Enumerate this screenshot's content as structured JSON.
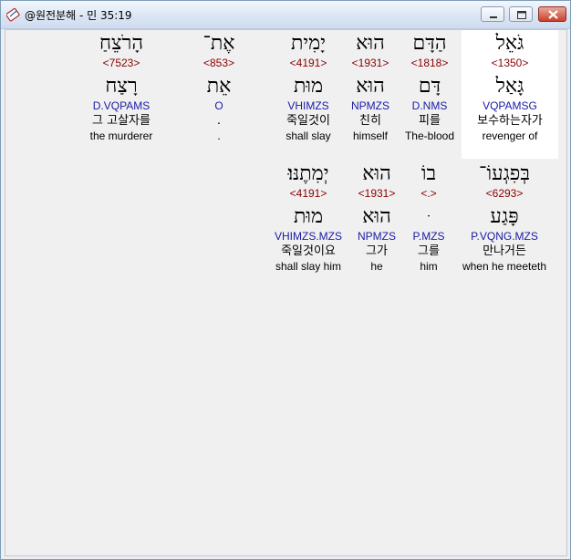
{
  "window": {
    "title": "@원전분해 - 민 35:19",
    "buttons": {
      "minimize": "minimize",
      "maximize": "maximize",
      "close": "close"
    }
  },
  "rows": [
    {
      "words": [
        {
          "hebrew": "גֹּאֵל",
          "strong": "<1350>",
          "lemma": "גָּאַל",
          "morph": "VQPAMSG",
          "korean": "보수하는자가",
          "english": "revenger of",
          "selected": true
        },
        {
          "hebrew": "הַדָּם",
          "strong": "<1818>",
          "lemma": "דָּם",
          "morph": "D.NMS",
          "korean": "피를",
          "english": "The-blood"
        },
        {
          "hebrew": "הוּא",
          "strong": "<1931>",
          "lemma": "הוּא",
          "morph": "NPMZS",
          "korean": "친히",
          "english": "himself"
        },
        {
          "hebrew": "יָמִית",
          "strong": "<4191>",
          "lemma": "מוּת",
          "morph": "VHIMZS",
          "korean": "죽일것이",
          "english": "shall slay"
        },
        {
          "hebrew": "אֶת־",
          "strong": "<853>",
          "lemma": "אֵת",
          "morph": "O",
          "korean": ".",
          "english": "."
        },
        {
          "hebrew": "הָרֹצֵחַ",
          "strong": "<7523>",
          "lemma": "רָצַח",
          "morph": "D.VQPAMS",
          "korean": "그 고살자를",
          "english": "the murderer"
        }
      ]
    },
    {
      "words": [
        {
          "hebrew": "בְּפִגְעוֹ־",
          "strong": "<6293>",
          "lemma": "פָּגַע",
          "morph": "P.VQNG.MZS",
          "korean": "만나거든",
          "english": "when he meeteth"
        },
        {
          "hebrew": "בוֹ",
          "strong": "<.>",
          "lemma": "ּ",
          "morph": "P.MZS",
          "korean": "그를",
          "english": "him"
        },
        {
          "hebrew": "הוּא",
          "strong": "<1931>",
          "lemma": "הוּא",
          "morph": "NPMZS",
          "korean": "그가",
          "english": "he"
        },
        {
          "hebrew": "יְמִתֶנּוּ׃",
          "strong": "<4191>",
          "lemma": "מוּת",
          "morph": "VHIMZS.MZS",
          "korean": "죽일것이요",
          "english": "shall slay him"
        }
      ]
    }
  ],
  "colors": {
    "strong": "#8b0000",
    "morph": "#1a1aa6",
    "selected_bg": "#ffffff",
    "background": "#f0f0f0"
  }
}
